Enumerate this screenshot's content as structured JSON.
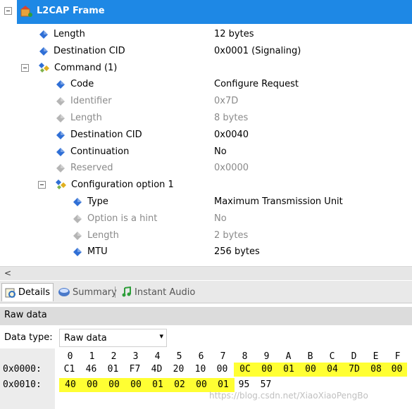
{
  "tree": {
    "title": "L2CAP Frame",
    "rows": [
      {
        "label": "Length",
        "value": "12 bytes",
        "dim": false
      },
      {
        "label": "Destination CID",
        "value": "0x0001 (Signaling)",
        "dim": false
      },
      {
        "label": "Command (1)",
        "value": "",
        "dim": false
      },
      {
        "label": "Code",
        "value": "Configure Request",
        "dim": false
      },
      {
        "label": "Identifier",
        "value": "0x7D",
        "dim": true
      },
      {
        "label": "Length",
        "value": "8 bytes",
        "dim": true
      },
      {
        "label": "Destination CID",
        "value": "0x0040",
        "dim": false
      },
      {
        "label": "Continuation",
        "value": "No",
        "dim": false
      },
      {
        "label": "Reserved",
        "value": "0x0000",
        "dim": true
      },
      {
        "label": "Configuration option 1",
        "value": "",
        "dim": false
      },
      {
        "label": "Type",
        "value": "Maximum Transmission Unit",
        "dim": false
      },
      {
        "label": "Option is a hint",
        "value": "No",
        "dim": true
      },
      {
        "label": "Length",
        "value": "2 bytes",
        "dim": true
      },
      {
        "label": "MTU",
        "value": "256 bytes",
        "dim": false
      }
    ]
  },
  "scrollbar": {
    "left_arrow": "<"
  },
  "tabs": [
    {
      "label": "Details",
      "icon": "details-icon",
      "active": true
    },
    {
      "label": "Summary",
      "icon": "summary-icon",
      "active": false
    },
    {
      "label": "Instant Audio",
      "icon": "audio-icon",
      "active": false
    }
  ],
  "raw": {
    "title": "Raw data",
    "data_type_label": "Data type:",
    "data_type_value": "Raw data",
    "header": [
      "0",
      "1",
      "2",
      "3",
      "4",
      "5",
      "6",
      "7",
      "8",
      "9",
      "A",
      "B",
      "C",
      "D",
      "E",
      "F"
    ],
    "rows": [
      {
        "addr": "0x0000:",
        "bytes": [
          "C1",
          "46",
          "01",
          "F7",
          "4D",
          "20",
          "10",
          "00",
          "0C",
          "00",
          "01",
          "00",
          "04",
          "7D",
          "08",
          "00"
        ]
      },
      {
        "addr": "0x0010:",
        "bytes": [
          "40",
          "00",
          "00",
          "00",
          "01",
          "02",
          "00",
          "01",
          "95",
          "57"
        ]
      }
    ],
    "highlight_from": 8,
    "highlight_count": 16,
    "highlight_color": "#ffff33"
  },
  "watermark": "https://blog.csdn.net/XiaoXiaoPengBo",
  "colors": {
    "header_bg": "#1e88e5",
    "diamond": "#2f6fd6",
    "diamond_dim": "#b5b5b5"
  }
}
